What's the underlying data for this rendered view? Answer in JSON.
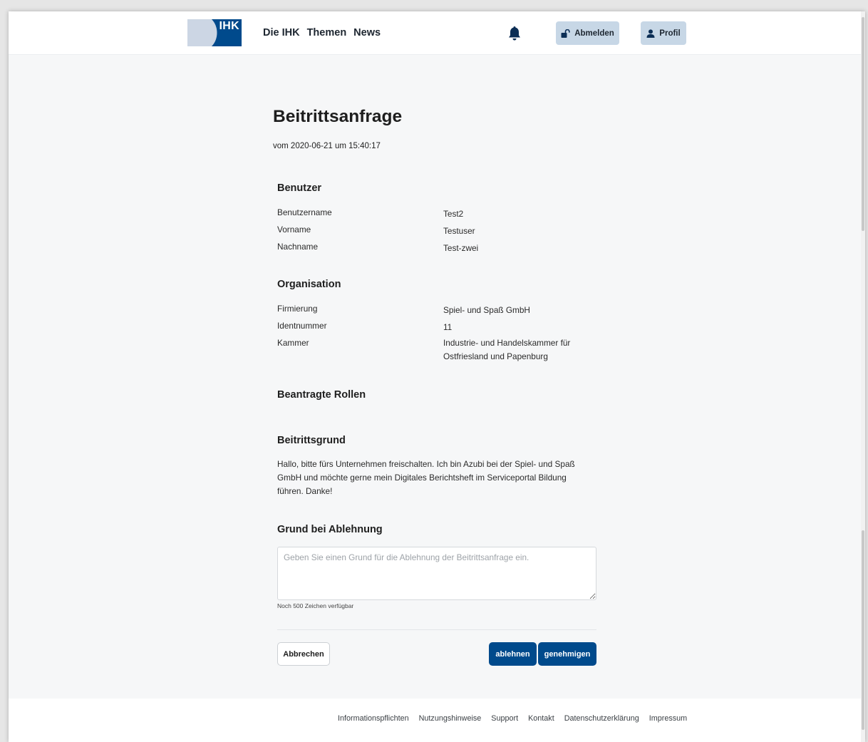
{
  "header": {
    "logo_text": "IHK",
    "nav": [
      "Die IHK",
      "Themen",
      "News"
    ],
    "logout_label": "Abmelden",
    "profile_label": "Profil"
  },
  "page": {
    "title": "Beitrittsanfrage",
    "date_line": "vom 2020-06-21 um 15:40:17"
  },
  "user": {
    "heading": "Benutzer",
    "rows": [
      {
        "label": "Benutzername",
        "value": "Test2"
      },
      {
        "label": "Vorname",
        "value": "Testuser"
      },
      {
        "label": "Nachname",
        "value": "Test-zwei"
      }
    ]
  },
  "organisation": {
    "heading": "Organisation",
    "rows": [
      {
        "label": "Firmierung",
        "value": "Spiel- und Spaß GmbH"
      },
      {
        "label": "Identnummer",
        "value": "11"
      },
      {
        "label": "Kammer",
        "value": "Industrie- und Handelskammer für Ostfriesland und Papenburg"
      }
    ]
  },
  "roles": {
    "heading": "Beantragte Rollen"
  },
  "reason": {
    "heading": "Beitrittsgrund",
    "text": "Hallo, bitte fürs Unternehmen freischalten. Ich bin Azubi bei der Spiel- und Spaß GmbH und möchte gerne mein Digitales Berichtsheft im Serviceportal Bildung führen. Danke!"
  },
  "rejection": {
    "heading": "Grund bei Ablehnung",
    "placeholder": "Geben Sie einen Grund für die Ablehnung der Beitrittsanfrage ein.",
    "value": "",
    "counter": "Noch 500 Zeichen verfügbar"
  },
  "actions": {
    "cancel": "Abbrechen",
    "reject": "ablehnen",
    "approve": "genehmigen"
  },
  "footer": {
    "links": [
      "Informationspflichten",
      "Nutzungshinweise",
      "Support",
      "Kontakt",
      "Datenschutzerklärung",
      "Impressum"
    ]
  },
  "colors": {
    "primary": "#004a8c",
    "header_button_bg": "#c7d7e6",
    "page_bg": "#f6f7f8"
  },
  "icons": {
    "notifications": "bell-icon",
    "logout": "unlock-icon",
    "profile": "user-icon"
  }
}
